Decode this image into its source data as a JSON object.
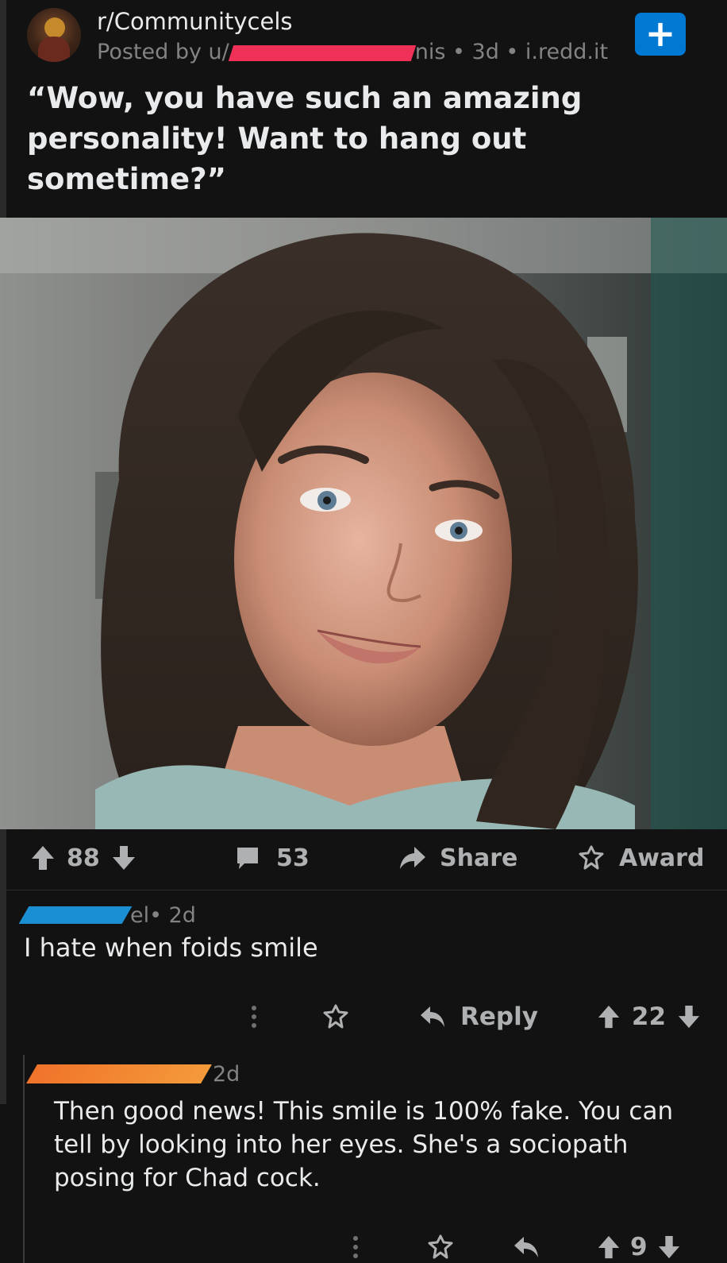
{
  "post": {
    "subreddit": "r/Communitycels",
    "posted_by_prefix": "Posted by u/",
    "username_visible_suffix": "nis",
    "meta_suffix": " • 3d • i.redd.it",
    "join_label": "+",
    "title": "“Wow, you have such an amazing personality! Want to hang out sometime?”"
  },
  "actions": {
    "upvotes": "88",
    "comments": "53",
    "share_label": "Share",
    "award_label": "Award"
  },
  "comments": [
    {
      "author_visible_suffix": "el",
      "age": " • 2d",
      "text": "I hate when foids smile",
      "reply_label": "Reply",
      "score": "22"
    },
    {
      "age": "2d",
      "text": "Then good news! This smile is 100% fake. You can tell by looking into her eyes. She's a sociopath posing for Chad cock.",
      "score": "9"
    }
  ],
  "colors": {
    "background": "#121212",
    "accent_blue": "#0079d3",
    "redact_red": "#ef3157",
    "redact_blue": "#1b8fd4",
    "redact_orange": "#f0732a"
  }
}
